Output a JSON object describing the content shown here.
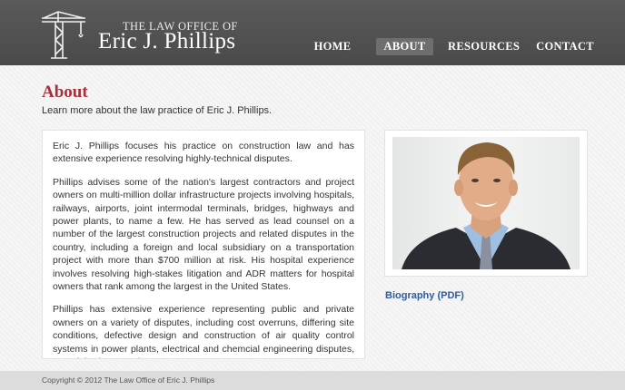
{
  "header": {
    "logo_small": "THE LAW OFFICE OF",
    "logo_name": "Eric J. Phillips",
    "nav": [
      {
        "label": "HOME",
        "active": false
      },
      {
        "label": "ABOUT",
        "active": true
      },
      {
        "label": "RESOURCES",
        "active": false
      },
      {
        "label": "CONTACT",
        "active": false
      }
    ]
  },
  "main": {
    "title": "About",
    "subtitle": "Learn more about the law practice of Eric J. Phillips.",
    "paragraphs": [
      "Eric J. Phillips focuses his practice on construction law and has extensive experience resolving highly-technical disputes.",
      "Phillips advises some of the nation's largest contractors and project owners on multi-million dollar infrastructure projects involving hospitals, railways, airports, joint intermodal terminals, bridges, highways and power plants, to name a few. He has served as lead counsel on a number of the largest construction projects and related disputes in the country, including a foreign and local subsidiary on a transportation project with more than $700 million at risk. His hospital experience involves resolving high-stakes litigation and ADR matters for hospital owners that rank among the largest in the United States.",
      "Phillips has extensive experience representing public and private owners on a variety of disputes, including cost overruns, differing site conditions, defective design and construction of air quality control systems in power plants, electrical and chemcial engineering disputes, material science and"
    ],
    "bio_link": "Biography (PDF)"
  },
  "footer": {
    "copyright": "Copyright © 2012 The Law Office of Eric J. Phillips"
  },
  "colors": {
    "header_bg": "#4f4f4f",
    "title_red": "#a8303b",
    "link_blue": "#2f5c9a"
  },
  "icons": {
    "logo": "crane-icon"
  }
}
